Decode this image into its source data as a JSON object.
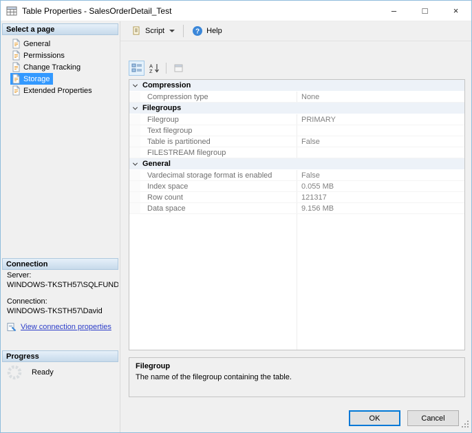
{
  "window": {
    "title": "Table Properties - SalesOrderDetail_Test",
    "controls": {
      "minimize": "–",
      "maximize": "□",
      "close": "×"
    }
  },
  "sidebar": {
    "select_page_header": "Select a page",
    "pages": [
      {
        "label": "General",
        "selected": false
      },
      {
        "label": "Permissions",
        "selected": false
      },
      {
        "label": "Change Tracking",
        "selected": false
      },
      {
        "label": "Storage",
        "selected": true
      },
      {
        "label": "Extended Properties",
        "selected": false
      }
    ],
    "connection_header": "Connection",
    "server_label": "Server:",
    "server_value": "WINDOWS-TKSTH57\\SQLFUND",
    "connection_label": "Connection:",
    "connection_value": "WINDOWS-TKSTH57\\David",
    "view_connection_link": "View connection properties",
    "progress_header": "Progress",
    "progress_status": "Ready"
  },
  "toolbar": {
    "script_label": "Script",
    "help_label": "Help"
  },
  "property_grid": {
    "groups": [
      {
        "name": "Compression",
        "rows": [
          {
            "name": "Compression type",
            "value": "None"
          }
        ]
      },
      {
        "name": "Filegroups",
        "rows": [
          {
            "name": "Filegroup",
            "value": "PRIMARY"
          },
          {
            "name": "Text filegroup",
            "value": ""
          },
          {
            "name": "Table is partitioned",
            "value": "False"
          },
          {
            "name": "FILESTREAM filegroup",
            "value": ""
          }
        ]
      },
      {
        "name": "General",
        "rows": [
          {
            "name": "Vardecimal storage format is enabled",
            "value": "False"
          },
          {
            "name": "Index space",
            "value": "0.055 MB"
          },
          {
            "name": "Row count",
            "value": "121317"
          },
          {
            "name": "Data space",
            "value": "9.156 MB"
          }
        ]
      }
    ],
    "description": {
      "title": "Filegroup",
      "text": "The name of the filegroup containing the table."
    }
  },
  "footer": {
    "ok_label": "OK",
    "cancel_label": "Cancel"
  },
  "icons": {
    "app": "table-icon",
    "script": "script-file-icon",
    "help": "help-icon",
    "categorized": "categorized-view-icon",
    "alphabetical": "alphabetical-sort-icon",
    "property_pages": "property-pages-icon",
    "page": "page-icon",
    "connection": "connection-properties-icon",
    "progress": "progress-spinner-icon"
  }
}
